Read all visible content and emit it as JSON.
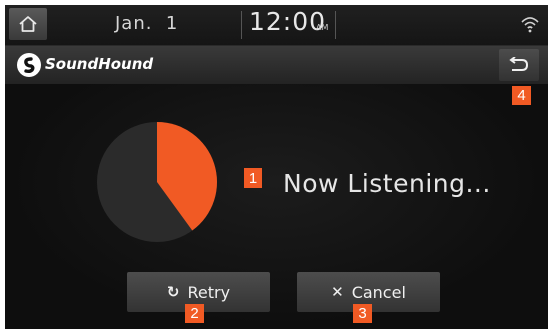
{
  "status_bar": {
    "date": "Jan.  1",
    "time": "12:00",
    "ampm": "AM",
    "icons": [
      "home-icon",
      "wifi-icon"
    ]
  },
  "title_bar": {
    "app_name": "SoundHound",
    "back_icon": "back-arrow-icon"
  },
  "listening": {
    "status_text": "Now Listening...",
    "progress_fraction": 0.4,
    "colors": {
      "progress": "#f15a24",
      "remainder": "#2b2b2b"
    }
  },
  "buttons": {
    "retry_label": "Retry",
    "cancel_label": "Cancel"
  },
  "markers": {
    "m1": "1",
    "m2": "2",
    "m3": "3",
    "m4": "4"
  },
  "colors": {
    "accent": "#f15a24",
    "background": "#0d0d0d"
  }
}
